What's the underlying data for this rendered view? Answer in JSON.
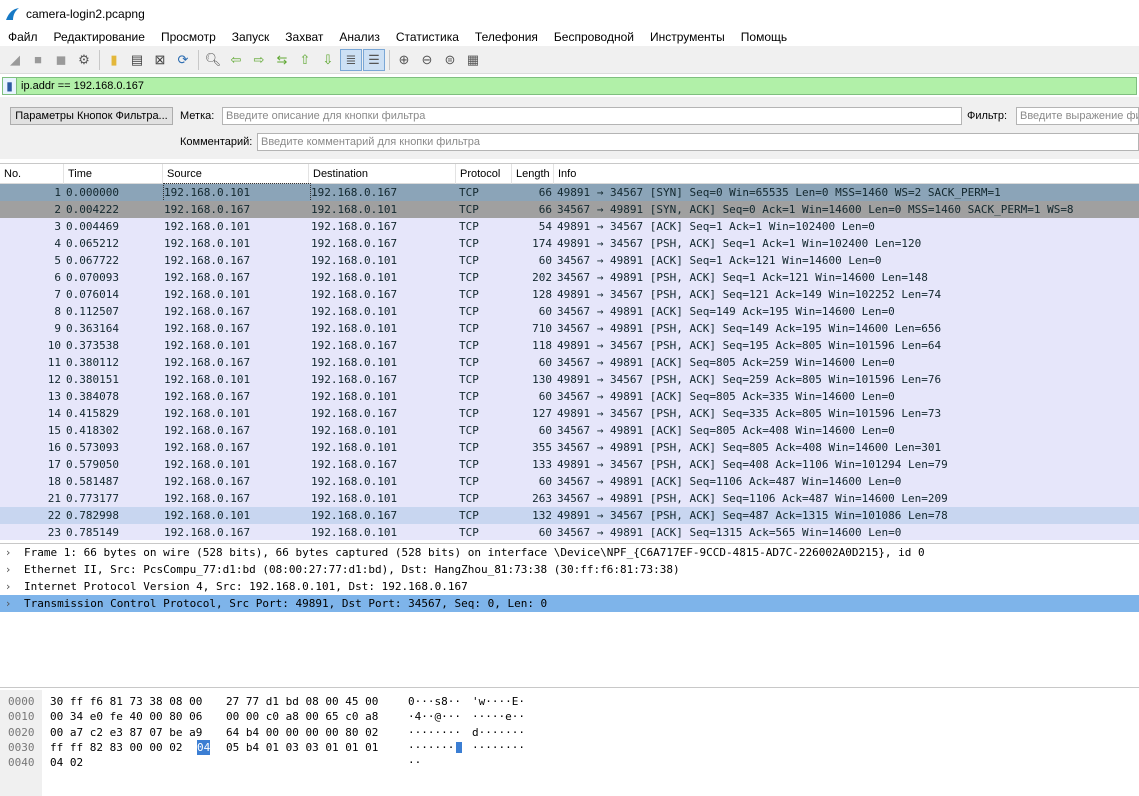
{
  "window": {
    "title": "camera-login2.pcapng"
  },
  "menu": [
    "Файл",
    "Редактирование",
    "Просмотр",
    "Запуск",
    "Захват",
    "Анализ",
    "Статистика",
    "Телефония",
    "Беспроводной",
    "Инструменты",
    "Помощь"
  ],
  "filter": {
    "value": "ip.addr == 192.168.0.167"
  },
  "filter_buttons": {
    "params_button": "Параметры Кнопок Фильтра...",
    "label_label": "Метка:",
    "label_placeholder": "Введите описание для кнопки фильтра",
    "filter_label": "Фильтр:",
    "filter_placeholder": "Введите выражение фильтра",
    "comment_label": "Комментарий:",
    "comment_placeholder": "Введите комментарий для кнопки фильтра"
  },
  "packet_list": {
    "columns": [
      "No.",
      "Time",
      "Source",
      "Destination",
      "Protocol",
      "Length",
      "Info"
    ],
    "rows": [
      {
        "no": "1",
        "time": "0.000000",
        "src": "192.168.0.101",
        "dst": "192.168.0.167",
        "proto": "TCP",
        "len": "66",
        "info": "49891 → 34567 [SYN] Seq=0 Win=65535 Len=0 MSS=1460 WS=2 SACK_PERM=1"
      },
      {
        "no": "2",
        "time": "0.004222",
        "src": "192.168.0.167",
        "dst": "192.168.0.101",
        "proto": "TCP",
        "len": "66",
        "info": "34567 → 49891 [SYN, ACK] Seq=0 Ack=1 Win=14600 Len=0 MSS=1460 SACK_PERM=1 WS=8"
      },
      {
        "no": "3",
        "time": "0.004469",
        "src": "192.168.0.101",
        "dst": "192.168.0.167",
        "proto": "TCP",
        "len": "54",
        "info": "49891 → 34567 [ACK] Seq=1 Ack=1 Win=102400 Len=0"
      },
      {
        "no": "4",
        "time": "0.065212",
        "src": "192.168.0.101",
        "dst": "192.168.0.167",
        "proto": "TCP",
        "len": "174",
        "info": "49891 → 34567 [PSH, ACK] Seq=1 Ack=1 Win=102400 Len=120"
      },
      {
        "no": "5",
        "time": "0.067722",
        "src": "192.168.0.167",
        "dst": "192.168.0.101",
        "proto": "TCP",
        "len": "60",
        "info": "34567 → 49891 [ACK] Seq=1 Ack=121 Win=14600 Len=0"
      },
      {
        "no": "6",
        "time": "0.070093",
        "src": "192.168.0.167",
        "dst": "192.168.0.101",
        "proto": "TCP",
        "len": "202",
        "info": "34567 → 49891 [PSH, ACK] Seq=1 Ack=121 Win=14600 Len=148"
      },
      {
        "no": "7",
        "time": "0.076014",
        "src": "192.168.0.101",
        "dst": "192.168.0.167",
        "proto": "TCP",
        "len": "128",
        "info": "49891 → 34567 [PSH, ACK] Seq=121 Ack=149 Win=102252 Len=74"
      },
      {
        "no": "8",
        "time": "0.112507",
        "src": "192.168.0.167",
        "dst": "192.168.0.101",
        "proto": "TCP",
        "len": "60",
        "info": "34567 → 49891 [ACK] Seq=149 Ack=195 Win=14600 Len=0"
      },
      {
        "no": "9",
        "time": "0.363164",
        "src": "192.168.0.167",
        "dst": "192.168.0.101",
        "proto": "TCP",
        "len": "710",
        "info": "34567 → 49891 [PSH, ACK] Seq=149 Ack=195 Win=14600 Len=656"
      },
      {
        "no": "10",
        "time": "0.373538",
        "src": "192.168.0.101",
        "dst": "192.168.0.167",
        "proto": "TCP",
        "len": "118",
        "info": "49891 → 34567 [PSH, ACK] Seq=195 Ack=805 Win=101596 Len=64"
      },
      {
        "no": "11",
        "time": "0.380112",
        "src": "192.168.0.167",
        "dst": "192.168.0.101",
        "proto": "TCP",
        "len": "60",
        "info": "34567 → 49891 [ACK] Seq=805 Ack=259 Win=14600 Len=0"
      },
      {
        "no": "12",
        "time": "0.380151",
        "src": "192.168.0.101",
        "dst": "192.168.0.167",
        "proto": "TCP",
        "len": "130",
        "info": "49891 → 34567 [PSH, ACK] Seq=259 Ack=805 Win=101596 Len=76"
      },
      {
        "no": "13",
        "time": "0.384078",
        "src": "192.168.0.167",
        "dst": "192.168.0.101",
        "proto": "TCP",
        "len": "60",
        "info": "34567 → 49891 [ACK] Seq=805 Ack=335 Win=14600 Len=0"
      },
      {
        "no": "14",
        "time": "0.415829",
        "src": "192.168.0.101",
        "dst": "192.168.0.167",
        "proto": "TCP",
        "len": "127",
        "info": "49891 → 34567 [PSH, ACK] Seq=335 Ack=805 Win=101596 Len=73"
      },
      {
        "no": "15",
        "time": "0.418302",
        "src": "192.168.0.167",
        "dst": "192.168.0.101",
        "proto": "TCP",
        "len": "60",
        "info": "34567 → 49891 [ACK] Seq=805 Ack=408 Win=14600 Len=0"
      },
      {
        "no": "16",
        "time": "0.573093",
        "src": "192.168.0.167",
        "dst": "192.168.0.101",
        "proto": "TCP",
        "len": "355",
        "info": "34567 → 49891 [PSH, ACK] Seq=805 Ack=408 Win=14600 Len=301"
      },
      {
        "no": "17",
        "time": "0.579050",
        "src": "192.168.0.101",
        "dst": "192.168.0.167",
        "proto": "TCP",
        "len": "133",
        "info": "49891 → 34567 [PSH, ACK] Seq=408 Ack=1106 Win=101294 Len=79"
      },
      {
        "no": "18",
        "time": "0.581487",
        "src": "192.168.0.167",
        "dst": "192.168.0.101",
        "proto": "TCP",
        "len": "60",
        "info": "34567 → 49891 [ACK] Seq=1106 Ack=487 Win=14600 Len=0"
      },
      {
        "no": "21",
        "time": "0.773177",
        "src": "192.168.0.167",
        "dst": "192.168.0.101",
        "proto": "TCP",
        "len": "263",
        "info": "34567 → 49891 [PSH, ACK] Seq=1106 Ack=487 Win=14600 Len=209"
      },
      {
        "no": "22",
        "time": "0.782998",
        "src": "192.168.0.101",
        "dst": "192.168.0.167",
        "proto": "TCP",
        "len": "132",
        "info": "49891 → 34567 [PSH, ACK] Seq=487 Ack=1315 Win=101086 Len=78"
      },
      {
        "no": "23",
        "time": "0.785149",
        "src": "192.168.0.167",
        "dst": "192.168.0.101",
        "proto": "TCP",
        "len": "60",
        "info": "34567 → 49891 [ACK] Seq=1315 Ack=565 Win=14600 Len=0"
      }
    ]
  },
  "details": [
    "Frame 1: 66 bytes on wire (528 bits), 66 bytes captured (528 bits) on interface \\Device\\NPF_{C6A717EF-9CCD-4815-AD7C-226002A0D215}, id 0",
    "Ethernet II, Src: PcsCompu_77:d1:bd (08:00:27:77:d1:bd), Dst: HangZhou_81:73:38 (30:ff:f6:81:73:38)",
    "Internet Protocol Version 4, Src: 192.168.0.101, Dst: 192.168.0.167",
    "Transmission Control Protocol, Src Port: 49891, Dst Port: 34567, Seq: 0, Len: 0"
  ],
  "hex": {
    "offsets": [
      "0000",
      "0010",
      "0020",
      "0030",
      "0040"
    ],
    "bytes_a": [
      "30 ff f6 81 73 38 08 00",
      "00 34 e0 fe 40 00 80 06",
      "00 a7 c2 e3 87 07 be a9",
      "ff ff 82 83 00 00 02",
      "04 02"
    ],
    "highlight_byte": "04",
    "bytes_b": [
      "27 77 d1 bd 08 00 45 00",
      "00 00 c0 a8 00 65 c0 a8",
      "64 b4 00 00 00 00 80 02",
      "05 b4 01 03 03 01 01 01",
      ""
    ],
    "ascii_a": [
      "0···s8··",
      "·4··@···",
      "········",
      "········",
      "··"
    ],
    "ascii_b": [
      "'w····E·",
      "·····e··",
      "d·······",
      "········",
      ""
    ]
  }
}
